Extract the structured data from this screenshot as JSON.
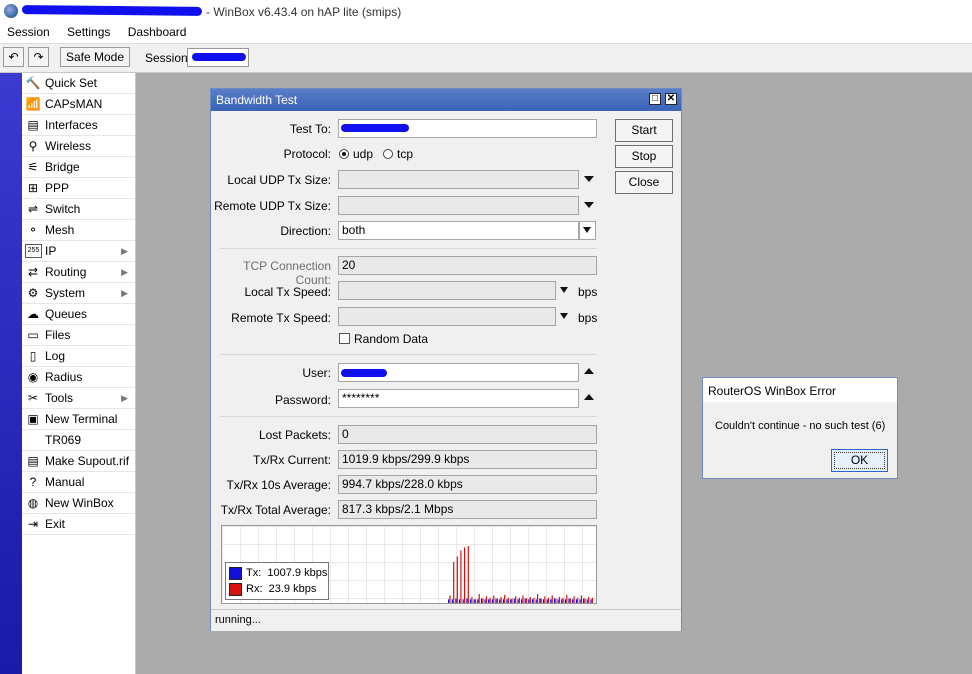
{
  "window": {
    "title": "- WinBox v6.43.4 on hAP lite (smips)"
  },
  "menu": [
    "Session",
    "Settings",
    "Dashboard"
  ],
  "toolbar": {
    "undo_icon": "↶",
    "redo_icon": "↷",
    "safe_mode_label": "Safe Mode",
    "session_label": "Session:"
  },
  "sidebar": {
    "items": [
      {
        "label": "Quick Set",
        "icon": "🔨",
        "submenu": false
      },
      {
        "label": "CAPsMAN",
        "icon": "📶",
        "submenu": false
      },
      {
        "label": "Interfaces",
        "icon": "▤",
        "submenu": false
      },
      {
        "label": "Wireless",
        "icon": "⚲",
        "submenu": false
      },
      {
        "label": "Bridge",
        "icon": "⚟",
        "submenu": false
      },
      {
        "label": "PPP",
        "icon": "⊞",
        "submenu": false
      },
      {
        "label": "Switch",
        "icon": "⇌",
        "submenu": false
      },
      {
        "label": "Mesh",
        "icon": "⚬",
        "submenu": false
      },
      {
        "label": "IP",
        "icon": "255",
        "submenu": true
      },
      {
        "label": "Routing",
        "icon": "⇄",
        "submenu": true
      },
      {
        "label": "System",
        "icon": "⚙",
        "submenu": true
      },
      {
        "label": "Queues",
        "icon": "☁",
        "submenu": false
      },
      {
        "label": "Files",
        "icon": "▭",
        "submenu": false
      },
      {
        "label": "Log",
        "icon": "▯",
        "submenu": false
      },
      {
        "label": "Radius",
        "icon": "◉",
        "submenu": false
      },
      {
        "label": "Tools",
        "icon": "✂",
        "submenu": true
      },
      {
        "label": "New Terminal",
        "icon": "▣",
        "submenu": false
      },
      {
        "label": "TR069",
        "icon": "",
        "submenu": false
      },
      {
        "label": "Make Supout.rif",
        "icon": "▤",
        "submenu": false
      },
      {
        "label": "Manual",
        "icon": "?",
        "submenu": false
      },
      {
        "label": "New WinBox",
        "icon": "◍",
        "submenu": false
      },
      {
        "label": "Exit",
        "icon": "⇥",
        "submenu": false
      }
    ]
  },
  "bandwidth_test": {
    "title": "Bandwidth Test",
    "max_icon": "□",
    "close_icon": "✕",
    "test_to_label": "Test To:",
    "protocol_label": "Protocol:",
    "protocol_udp": "udp",
    "protocol_tcp": "tcp",
    "local_udp_tx_size_label": "Local UDP Tx Size:",
    "remote_udp_tx_size_label": "Remote UDP Tx Size:",
    "direction_label": "Direction:",
    "direction_value": "both",
    "tcp_connection_count_label": "TCP Connection Count:",
    "tcp_connection_count_value": "20",
    "local_tx_speed_label": "Local Tx Speed:",
    "remote_tx_speed_label": "Remote Tx Speed:",
    "bps_unit": "bps",
    "random_data_label": "Random Data",
    "user_label": "User:",
    "password_label": "Password:",
    "password_value": "********",
    "lost_packets_label": "Lost Packets:",
    "lost_packets_value": "0",
    "txrx_current_label": "Tx/Rx Current:",
    "txrx_current_value": "1019.9 kbps/299.9 kbps",
    "txrx_10s_label": "Tx/Rx 10s Average:",
    "txrx_10s_value": "994.7 kbps/228.0 kbps",
    "txrx_total_label": "Tx/Rx Total Average:",
    "txrx_total_value": "817.3 kbps/2.1 Mbps",
    "start_label": "Start",
    "stop_label": "Stop",
    "close_label": "Close",
    "legend_tx_label": "Tx:",
    "legend_tx_value": "1007.9 kbps",
    "legend_rx_label": "Rx:",
    "legend_rx_value": "23.9 kbps",
    "status": "running..."
  },
  "error_dialog": {
    "title": "RouterOS WinBox Error",
    "message": "Couldn't continue - no such test (6)",
    "ok_label": "OK"
  },
  "colors": {
    "tx": "#1010d8",
    "rx": "#d81010",
    "accent": "#3a63b5",
    "redaction": "#1010ee"
  },
  "chart_data": {
    "type": "bar",
    "series": [
      {
        "name": "Tx",
        "values": [
          0.05,
          0.05,
          0.06,
          0.05,
          0.05,
          0.06,
          0.05,
          0.05,
          0.05,
          0.06,
          0.05,
          0.05,
          0.05,
          0.06,
          0.05,
          0.05,
          0.05,
          0.05,
          0.06,
          0.05,
          0.05,
          0.06,
          0.05,
          0.05,
          0.05,
          0.06,
          0.05,
          0.05,
          0.05,
          0.06,
          0.05,
          0.05,
          0.05,
          0.06,
          0.05,
          0.05,
          0.05,
          0.06,
          0.05,
          0.05
        ]
      },
      {
        "name": "Rx",
        "values": [
          0.1,
          0.55,
          0.62,
          0.7,
          0.74,
          0.76,
          0.08,
          0.05,
          0.12,
          0.06,
          0.09,
          0.07,
          0.1,
          0.06,
          0.08,
          0.11,
          0.07,
          0.06,
          0.09,
          0.07,
          0.1,
          0.06,
          0.08,
          0.07,
          0.12,
          0.06,
          0.09,
          0.07,
          0.1,
          0.06,
          0.08,
          0.07,
          0.11,
          0.06,
          0.09,
          0.07,
          0.1,
          0.06,
          0.08,
          0.07
        ]
      }
    ],
    "ylim": [
      0,
      1
    ]
  }
}
